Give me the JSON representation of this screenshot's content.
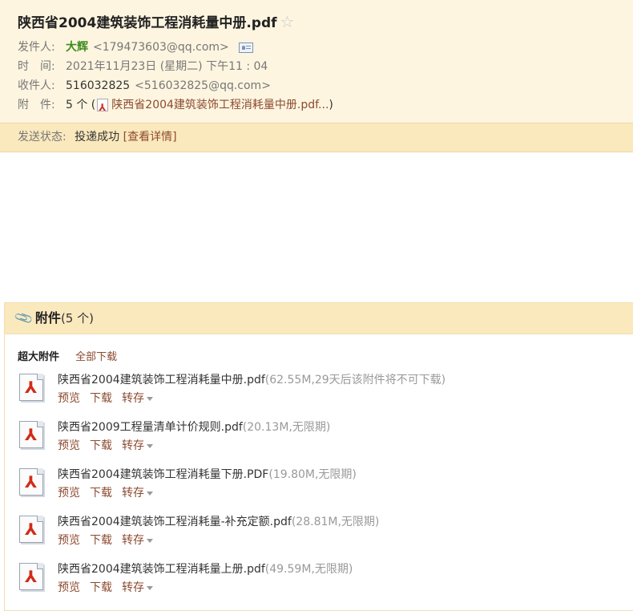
{
  "mail": {
    "subject": "陕西省2004建筑装饰工程消耗量中册.pdf",
    "star": "☆",
    "from_label": "发件人:",
    "from_name": "大辉",
    "from_email": "<179473603@qq.com>",
    "time_label": "时　间:",
    "time_value": "2021年11月23日 (星期二) 下午11 : 04",
    "to_label": "收件人:",
    "to_name": "516032825",
    "to_email": "<516032825@qq.com>",
    "attach_label": "附　件:",
    "attach_count": "5 个 (",
    "attach_link": "陕西省2004建筑装饰工程消耗量中册.pdf...",
    "attach_close": ")"
  },
  "status": {
    "label": "发送状态:",
    "value": "投递成功",
    "link": "[查看详情]"
  },
  "attachments": {
    "title": "附件",
    "count": "(5 个)",
    "big_label": "超大附件",
    "download_all": "全部下载",
    "actions": {
      "preview": "预览",
      "download": "下载",
      "save": "转存"
    },
    "items": [
      {
        "name": "陕西省2004建筑装饰工程消耗量中册.pdf",
        "meta": "(62.55M,29天后该附件将不可下载)"
      },
      {
        "name": "陕西省2009工程量清单计价规则.pdf",
        "meta": "(20.13M,无限期)"
      },
      {
        "name": "陕西省2004建筑装饰工程消耗量下册.PDF",
        "meta": "(19.80M,无限期)"
      },
      {
        "name": "陕西省2004建筑装饰工程消耗量-补充定额.pdf",
        "meta": "(28.81M,无限期)"
      },
      {
        "name": "陕西省2004建筑装饰工程消耗量上册.pdf",
        "meta": "(49.59M,无限期)"
      }
    ]
  }
}
